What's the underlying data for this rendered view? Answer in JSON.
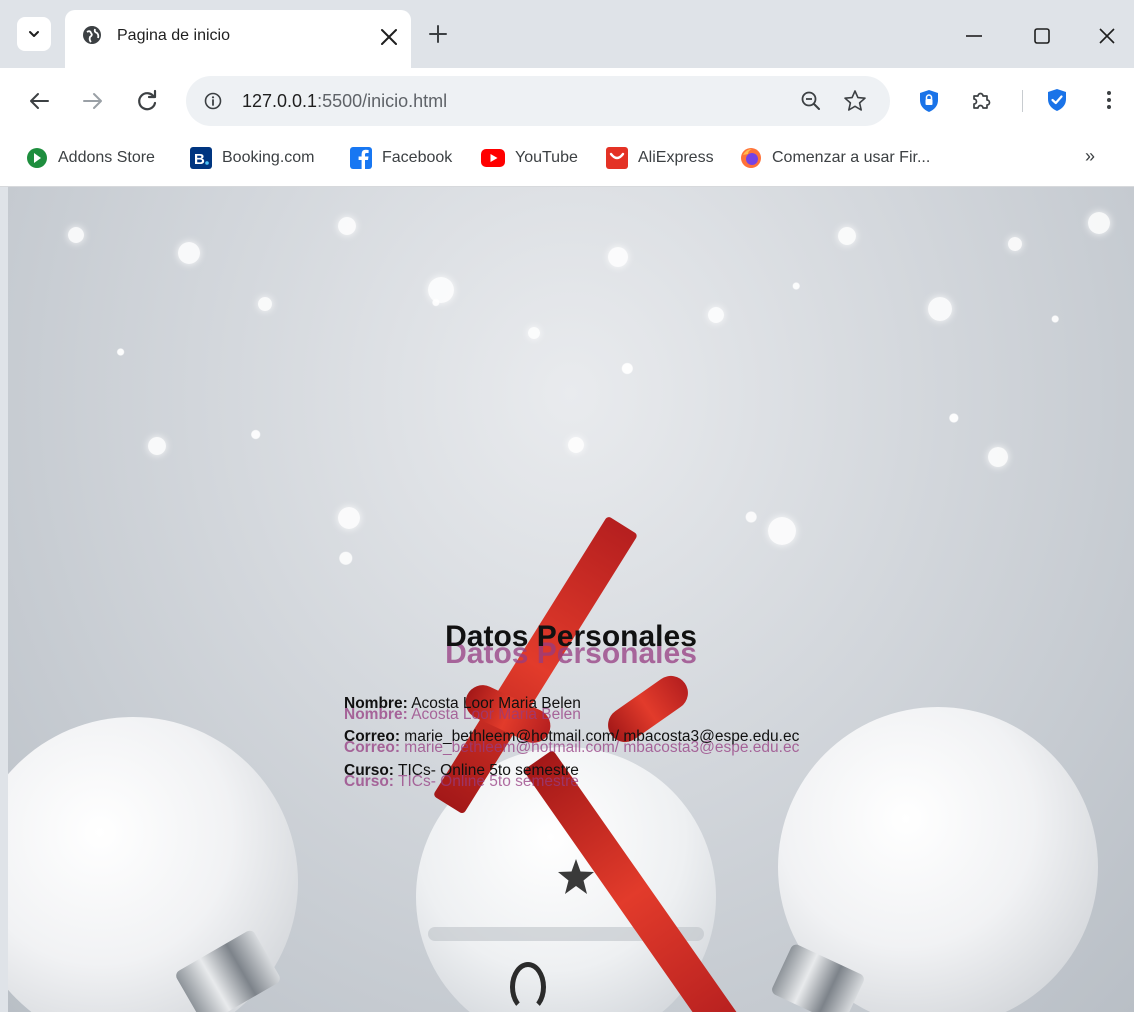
{
  "browser": {
    "tab": {
      "title": "Pagina de inicio"
    },
    "address_bar": {
      "host": "127.0.0.1",
      "path": ":5500/inicio.html"
    },
    "bookmarks": [
      {
        "label": "Addons Store",
        "icon": "addons-icon",
        "color": "#1e8e3e"
      },
      {
        "label": "Booking.com",
        "icon": "booking-icon",
        "color": "#003580"
      },
      {
        "label": "Facebook",
        "icon": "facebook-icon",
        "color": "#1877f2"
      },
      {
        "label": "YouTube",
        "icon": "youtube-icon",
        "color": "#ff0000"
      },
      {
        "label": "AliExpress",
        "icon": "aliexpress-icon",
        "color": "#e43225"
      },
      {
        "label": "Comenzar a usar Fir...",
        "icon": "firefox-icon",
        "color": "#ff7139"
      }
    ],
    "bookmarks_more": "»"
  },
  "page": {
    "heading": "Datos Personales",
    "fields": [
      {
        "label": "Nombre:",
        "value": "Acosta Loor Maria Belen"
      },
      {
        "label": "Correo:",
        "value": "marie_bethleem@hotmail.com/ mbacosta3@espe.edu.ec"
      },
      {
        "label": "Curso:",
        "value": "TICs- Online 5to semestre"
      }
    ]
  },
  "colors": {
    "text": "#111111",
    "text_shadow": "#963c82",
    "ribbon": "#d7302a"
  }
}
